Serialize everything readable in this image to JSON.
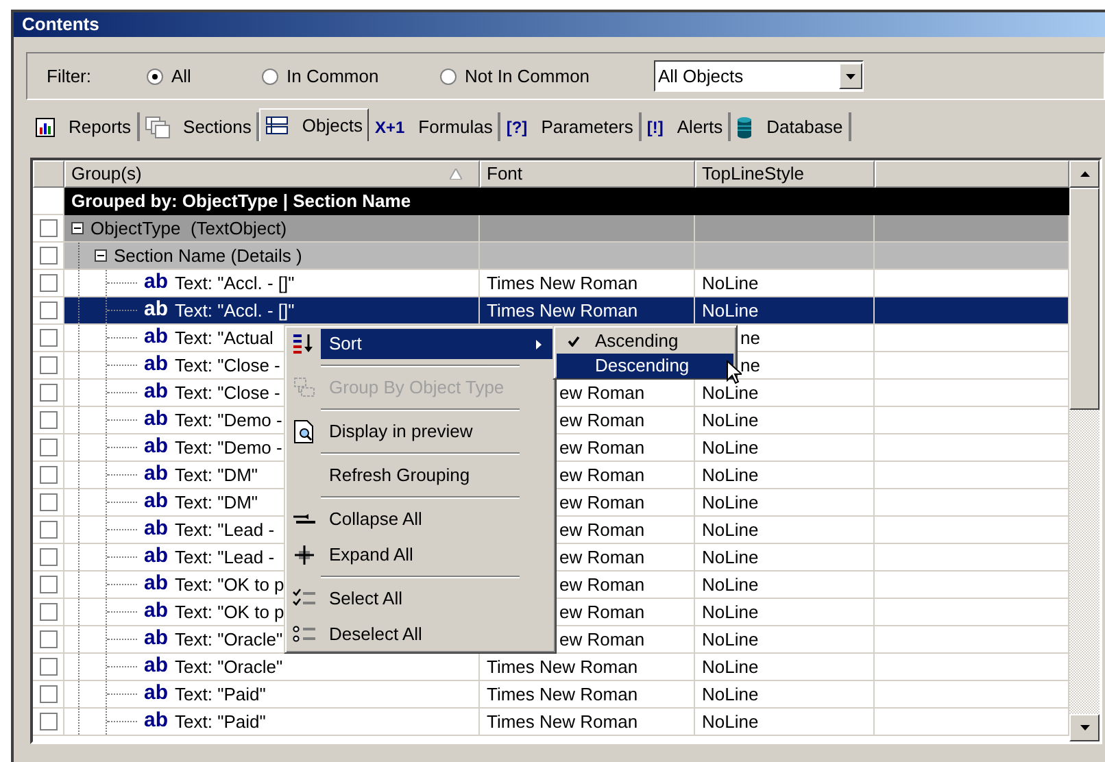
{
  "window": {
    "title": "Contents"
  },
  "filter": {
    "label": "Filter:",
    "options": [
      {
        "label": "All",
        "selected": true
      },
      {
        "label": "In Common",
        "selected": false
      },
      {
        "label": "Not In Common",
        "selected": false
      }
    ],
    "dropdown": {
      "value": "All Objects"
    }
  },
  "tabs": [
    {
      "label": "Reports",
      "selected": false
    },
    {
      "label": "Sections",
      "selected": false
    },
    {
      "label": "Objects",
      "selected": true
    },
    {
      "label": "Formulas",
      "symbol": "X+1",
      "selected": false
    },
    {
      "label": "Parameters",
      "symbol": "[?]",
      "selected": false
    },
    {
      "label": "Alerts",
      "symbol": "[!]",
      "selected": false
    },
    {
      "label": "Database",
      "selected": false
    }
  ],
  "table": {
    "columns": [
      {
        "label": "Group(s)",
        "sorted": true
      },
      {
        "label": "Font",
        "sorted": false
      },
      {
        "label": "TopLineStyle",
        "sorted": false
      }
    ],
    "grouped_by": "Grouped by: ObjectType | Section Name",
    "groups": [
      {
        "label": "ObjectType  (TextObject)",
        "checked": false,
        "expanded": true
      },
      {
        "label": "Section Name (Details )",
        "checked": false,
        "expanded": true
      }
    ],
    "rows": [
      {
        "badge": "ab",
        "name": "Text: \"Accl. - []\"",
        "font": "Times New Roman",
        "top_line_style": "NoLine",
        "checked": false,
        "selected": false
      },
      {
        "badge": "ab",
        "name": "Text: \"Accl. - []\"",
        "font": "Times New Roman",
        "top_line_style": "NoLine",
        "checked": false,
        "selected": true
      },
      {
        "badge": "ab",
        "name": "Text: \"Actual",
        "top_line_style": "ne",
        "checked": false,
        "selected": false
      },
      {
        "badge": "ab",
        "name": "Text: \"Close -",
        "top_line_style": "ne",
        "checked": false,
        "selected": false
      },
      {
        "badge": "ab",
        "name": "Text: \"Close -",
        "font": "ew Roman",
        "top_line_style": "NoLine",
        "checked": false,
        "selected": false
      },
      {
        "badge": "ab",
        "name": "Text: \"Demo -",
        "font": "ew Roman",
        "top_line_style": "NoLine",
        "checked": false,
        "selected": false
      },
      {
        "badge": "ab",
        "name": "Text: \"Demo -",
        "font": "ew Roman",
        "top_line_style": "NoLine",
        "checked": false,
        "selected": false
      },
      {
        "badge": "ab",
        "name": "Text: \"DM\"",
        "font": "ew Roman",
        "top_line_style": "NoLine",
        "checked": false,
        "selected": false
      },
      {
        "badge": "ab",
        "name": "Text: \"DM\"",
        "font": "ew Roman",
        "top_line_style": "NoLine",
        "checked": false,
        "selected": false
      },
      {
        "badge": "ab",
        "name": "Text: \"Lead -",
        "font": "ew Roman",
        "top_line_style": "NoLine",
        "checked": false,
        "selected": false
      },
      {
        "badge": "ab",
        "name": "Text: \"Lead -",
        "font": "ew Roman",
        "top_line_style": "NoLine",
        "checked": false,
        "selected": false
      },
      {
        "badge": "ab",
        "name": "Text: \"OK to p",
        "font": "ew Roman",
        "top_line_style": "NoLine",
        "checked": false,
        "selected": false
      },
      {
        "badge": "ab",
        "name": "Text: \"OK to p",
        "font": "ew Roman",
        "top_line_style": "NoLine",
        "checked": false,
        "selected": false
      },
      {
        "badge": "ab",
        "name": "Text: \"Oracle\"",
        "font": "ew Roman",
        "top_line_style": "NoLine",
        "checked": false,
        "selected": false
      },
      {
        "badge": "ab",
        "name": "Text: \"Oracle\"",
        "font": "Times New Roman",
        "top_line_style": "NoLine",
        "checked": false,
        "selected": false
      },
      {
        "badge": "ab",
        "name": "Text: \"Paid\"",
        "font": "Times New Roman",
        "top_line_style": "NoLine",
        "checked": false,
        "selected": false
      },
      {
        "badge": "ab",
        "name": "Text: \"Paid\"",
        "font": "Times New Roman",
        "top_line_style": "NoLine",
        "checked": false,
        "selected": false
      }
    ]
  },
  "context_menu": {
    "items": [
      {
        "kind": "item",
        "label": "Sort",
        "submenu": true,
        "selected": true,
        "disabled": false
      },
      {
        "kind": "separator"
      },
      {
        "kind": "item",
        "label": "Group By Object Type",
        "submenu": false,
        "selected": false,
        "disabled": true
      },
      {
        "kind": "separator"
      },
      {
        "kind": "item",
        "label": "Display in preview",
        "submenu": false,
        "selected": false,
        "disabled": false
      },
      {
        "kind": "separator"
      },
      {
        "kind": "item",
        "label": "Refresh Grouping",
        "submenu": false,
        "selected": false,
        "disabled": false
      },
      {
        "kind": "separator"
      },
      {
        "kind": "item",
        "label": "Collapse All",
        "submenu": false,
        "selected": false,
        "disabled": false
      },
      {
        "kind": "item",
        "label": "Expand All",
        "submenu": false,
        "selected": false,
        "disabled": false
      },
      {
        "kind": "separator"
      },
      {
        "kind": "item",
        "label": "Select All",
        "submenu": false,
        "selected": false,
        "disabled": false
      },
      {
        "kind": "item",
        "label": "Deselect All",
        "submenu": false,
        "selected": false,
        "disabled": false
      }
    ]
  },
  "submenu": {
    "items": [
      {
        "label": "Ascending",
        "checked": true,
        "selected": false
      },
      {
        "label": "Descending",
        "checked": false,
        "selected": true
      }
    ]
  }
}
